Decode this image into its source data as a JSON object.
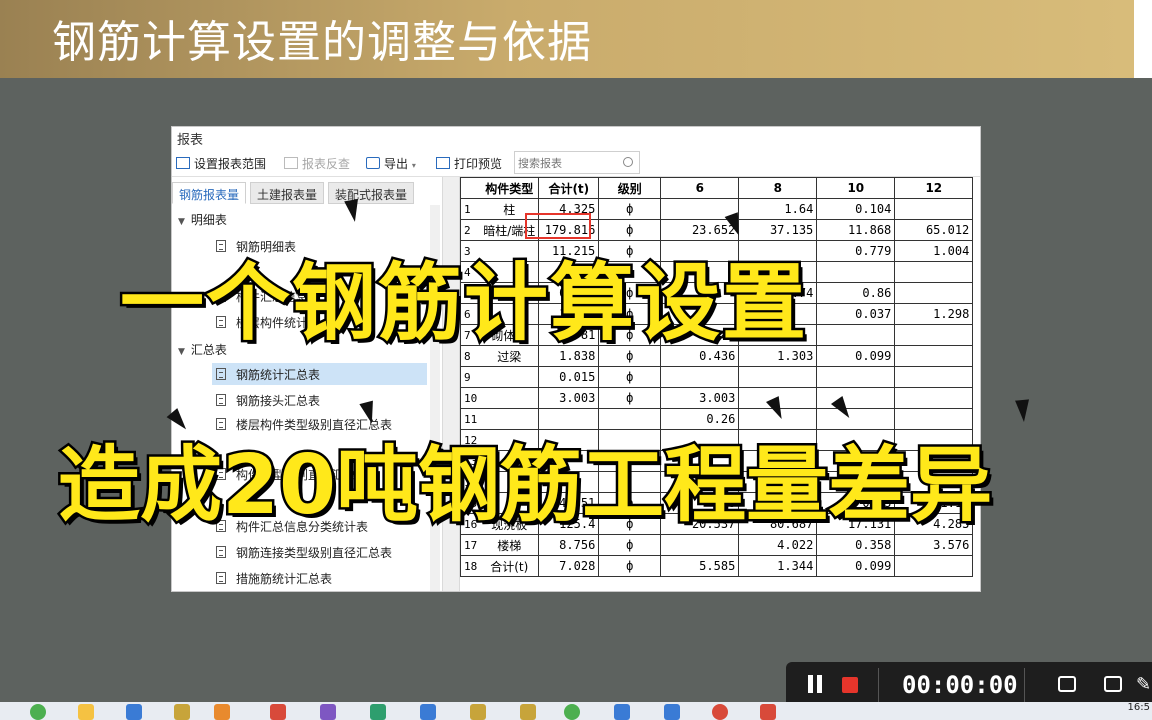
{
  "banner": {
    "title": "钢筋计算设置的调整与依据"
  },
  "window": {
    "title": "报表",
    "toolbar": {
      "set_scope": "设置报表范围",
      "reverse_check": "报表反查",
      "export": "导出",
      "print_preview": "打印预览",
      "search_placeholder": "搜索报表"
    },
    "tabs": [
      "钢筋报表量",
      "土建报表量",
      "装配式报表量"
    ],
    "tree": {
      "group1": "明细表",
      "group1_items": [
        "钢筋明细表",
        "构件汇总信息",
        "楼层构件统计"
      ],
      "group2": "汇总表",
      "group2_items": [
        "钢筋统计汇总表",
        "钢筋接头汇总表",
        "楼层构件类型级别直径汇总表",
        "构件类型级别直径汇总表",
        "",
        "构件汇总信息分类统计表",
        "钢筋连接类型级别直径汇总表",
        "措施筋统计汇总表"
      ]
    },
    "table": {
      "headers": [
        "构件类型",
        "合计(t)",
        "级别",
        "6",
        "8",
        "10",
        "12"
      ],
      "rows": [
        {
          "idx": "1",
          "type": "柱",
          "total": "4.325",
          "grade": "ф",
          "c6": "",
          "c8": "1.64",
          "c10": "0.104",
          "c12": ""
        },
        {
          "idx": "2",
          "type": "暗柱/端柱",
          "total": "179.816",
          "grade": "ф",
          "c6": "23.652",
          "c8": "37.135",
          "c10": "11.868",
          "c12": "65.012"
        },
        {
          "idx": "3",
          "type": "",
          "total": "11.215",
          "grade": "ф",
          "c6": "",
          "c8": "",
          "c10": "0.779",
          "c12": "1.004"
        },
        {
          "idx": "4",
          "type": "",
          "total": "",
          "grade": "",
          "c6": "",
          "c8": "",
          "c10": "",
          "c12": ""
        },
        {
          "idx": "5",
          "type": "",
          "total": "0.481",
          "grade": "ф",
          "c6": "",
          "c8": "0.74",
          "c10": "0.86",
          "c12": ""
        },
        {
          "idx": "6",
          "type": "",
          "total": "1.397",
          "grade": "ф",
          "c6": "",
          "c8": "",
          "c10": "0.037",
          "c12": "1.298"
        },
        {
          "idx": "7",
          "type": "砌体墙",
          "total": "6.781",
          "grade": "ф",
          "c6": "6.781",
          "c8": "",
          "c10": "",
          "c12": ""
        },
        {
          "idx": "8",
          "type": "过梁",
          "total": "1.838",
          "grade": "ф",
          "c6": "0.436",
          "c8": "1.303",
          "c10": "0.099",
          "c12": ""
        },
        {
          "idx": "9",
          "type": "",
          "total": "0.015",
          "grade": "ф",
          "c6": "",
          "c8": "",
          "c10": "",
          "c12": ""
        },
        {
          "idx": "10",
          "type": "",
          "total": "3.003",
          "grade": "ф",
          "c6": "3.003",
          "c8": "",
          "c10": "",
          "c12": ""
        },
        {
          "idx": "11",
          "type": "",
          "total": "",
          "grade": "",
          "c6": "0.26",
          "c8": "",
          "c10": "",
          "c12": ""
        },
        {
          "idx": "12",
          "type": "",
          "total": "",
          "grade": "",
          "c6": "",
          "c8": "",
          "c10": "",
          "c12": ""
        },
        {
          "idx": "13",
          "type": "",
          "total": "",
          "grade": "",
          "c6": "",
          "c8": "",
          "c10": "",
          "c12": ""
        },
        {
          "idx": "14",
          "type": "",
          "total": "",
          "grade": "",
          "c6": "",
          "c8": "",
          "c10": "",
          "c12": ""
        },
        {
          "idx": "15",
          "type": "",
          "total": "24.551",
          "grade": "ф",
          "c6": "5.6",
          "c8": "17.561",
          "c10": "0.03",
          "c12": "1.14"
        },
        {
          "idx": "16",
          "type": "现浇板",
          "total": "125.4",
          "grade": "ф",
          "c6": "20.537",
          "c8": "80.687",
          "c10": "17.131",
          "c12": "4.283"
        },
        {
          "idx": "17",
          "type": "楼梯",
          "total": "8.756",
          "grade": "ф",
          "c6": "",
          "c8": "4.022",
          "c10": "0.358",
          "c12": "3.576"
        },
        {
          "idx": "18",
          "type": "合计(t)",
          "total": "7.028",
          "grade": "ф",
          "c6": "5.585",
          "c8": "1.344",
          "c10": "0.099",
          "c12": ""
        }
      ]
    }
  },
  "captions": {
    "line1": "一个钢筋计算设置",
    "line2": "造成20吨钢筋工程量差异"
  },
  "recorder": {
    "time": "00:00:00"
  },
  "clock": "16:5",
  "colors": {
    "caption_fill": "#ffe81a",
    "highlight_box": "#e5352b",
    "banner": "#c9ab6c"
  }
}
